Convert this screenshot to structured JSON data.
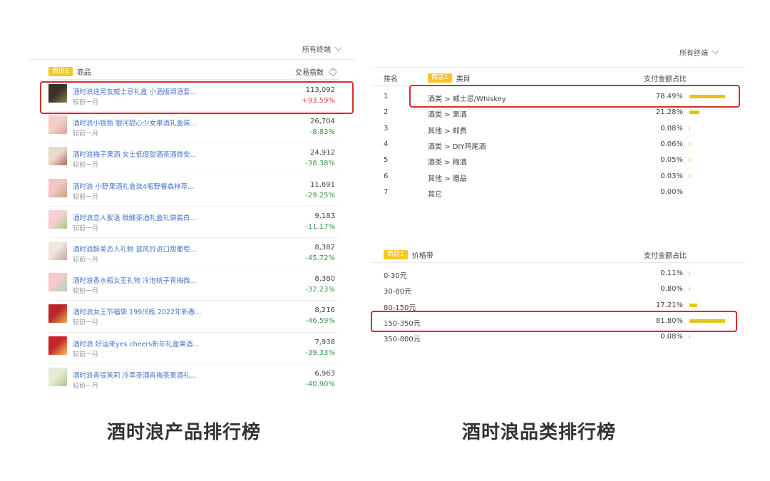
{
  "left": {
    "filter_label": "所有终端",
    "badge": "商店1",
    "col_product": "商品",
    "col_index": "交易指数",
    "compare_label": "较前一月",
    "products": [
      {
        "name": "酒时浪送男友威士忌礼盒 小酒版调酒套...",
        "value": "113,092",
        "change": "+93.59%",
        "dir": "pos",
        "thumb": [
          "#3a3128",
          "#8a7a50"
        ]
      },
      {
        "name": "酒时浪小银瓶 银河甜心少女果酒礼盒装...",
        "value": "26,704",
        "change": "-8.83%",
        "dir": "neg",
        "thumb": [
          "#f2d0c8",
          "#d9a6a0"
        ]
      },
      {
        "name": "酒时浪梅子果酒 女士低度甜酒茶酒微安...",
        "value": "24,912",
        "change": "-38.38%",
        "dir": "neg",
        "thumb": [
          "#e8dccf",
          "#b86a5a"
        ]
      },
      {
        "name": "酒时浪 小野果酒礼盒装4瓶野餐森林草...",
        "value": "11,691",
        "change": "-29.25%",
        "dir": "neg",
        "thumb": [
          "#f3c6c2",
          "#c9a37d"
        ]
      },
      {
        "name": "酒时浪恋人絮语 微醺茶酒礼盒礼袋装白...",
        "value": "9,183",
        "change": "-11.17%",
        "dir": "neg",
        "thumb": [
          "#f6cfd3",
          "#9fcf8a"
        ]
      },
      {
        "name": "酒时浪醉美恋人礼物 蓝风铃进口甜葡萄...",
        "value": "8,382",
        "change": "-45.72%",
        "dir": "neg",
        "thumb": [
          "#efe6df",
          "#c9a1a6"
        ]
      },
      {
        "name": "酒时浪香水瓶女王礼物 冷泡桃子青梅微...",
        "value": "8,380",
        "change": "-32.23%",
        "dir": "neg",
        "thumb": [
          "#f5c9cf",
          "#a8d6b0"
        ]
      },
      {
        "name": "酒时浪女王节福袋 199/6瓶 2022年新春...",
        "value": "8,216",
        "change": "-46.59%",
        "dir": "neg",
        "thumb": [
          "#b8262a",
          "#e6b04a"
        ]
      },
      {
        "name": "酒时浪 好运来yes cheers新年礼盒果酒...",
        "value": "7,938",
        "change": "-39.33%",
        "dir": "neg",
        "thumb": [
          "#c3262a",
          "#f2c66a"
        ]
      },
      {
        "name": "酒时浪青提茉莉 冷萃茶酒青梅茶果酒礼...",
        "value": "6,963",
        "change": "-40.90%",
        "dir": "neg",
        "thumb": [
          "#e4ecd4",
          "#a7c98a"
        ]
      }
    ]
  },
  "right": {
    "filter_label": "所有终端",
    "col_rank": "排名",
    "badge": "商店1",
    "col_category": "类目",
    "col_share": "支付金额占比",
    "categories": [
      {
        "rank": "1",
        "name": "酒类 > 威士忌/Whiskey",
        "pct": "78.49%",
        "share": 78.49
      },
      {
        "rank": "2",
        "name": "酒类 > 果酒",
        "pct": "21.28%",
        "share": 21.28
      },
      {
        "rank": "3",
        "name": "其他 > 邮费",
        "pct": "0.08%",
        "share": 0.08
      },
      {
        "rank": "4",
        "name": "酒类 > DIY鸡尾酒",
        "pct": "0.06%",
        "share": 0.06
      },
      {
        "rank": "5",
        "name": "酒类 > 梅酒",
        "pct": "0.05%",
        "share": 0.05
      },
      {
        "rank": "6",
        "name": "其他 > 赠品",
        "pct": "0.03%",
        "share": 0.03
      },
      {
        "rank": "7",
        "name": "其它",
        "pct": "0.00%",
        "share": 0.0
      }
    ],
    "price_badge": "商店1",
    "col_price": "价格带",
    "col_price_share": "支付金额占比",
    "prices": [
      {
        "name": "0-30元",
        "pct": "0.11%",
        "share": 0.11
      },
      {
        "name": "30-80元",
        "pct": "0.80%",
        "share": 0.8
      },
      {
        "name": "80-150元",
        "pct": "17.21%",
        "share": 17.21
      },
      {
        "name": "150-350元",
        "pct": "81.80%",
        "share": 81.8
      },
      {
        "name": "350-800元",
        "pct": "0.08%",
        "share": 0.08
      }
    ]
  },
  "captions": {
    "left": "酒时浪产品排行榜",
    "right": "酒时浪品类排行榜"
  },
  "colors": {
    "badge": "#f7c629",
    "bar": "#e3c41f",
    "highlight": "#d92c2c",
    "positive": "#e5483f",
    "negative": "#3c9a4f",
    "link": "#4a76c9"
  }
}
